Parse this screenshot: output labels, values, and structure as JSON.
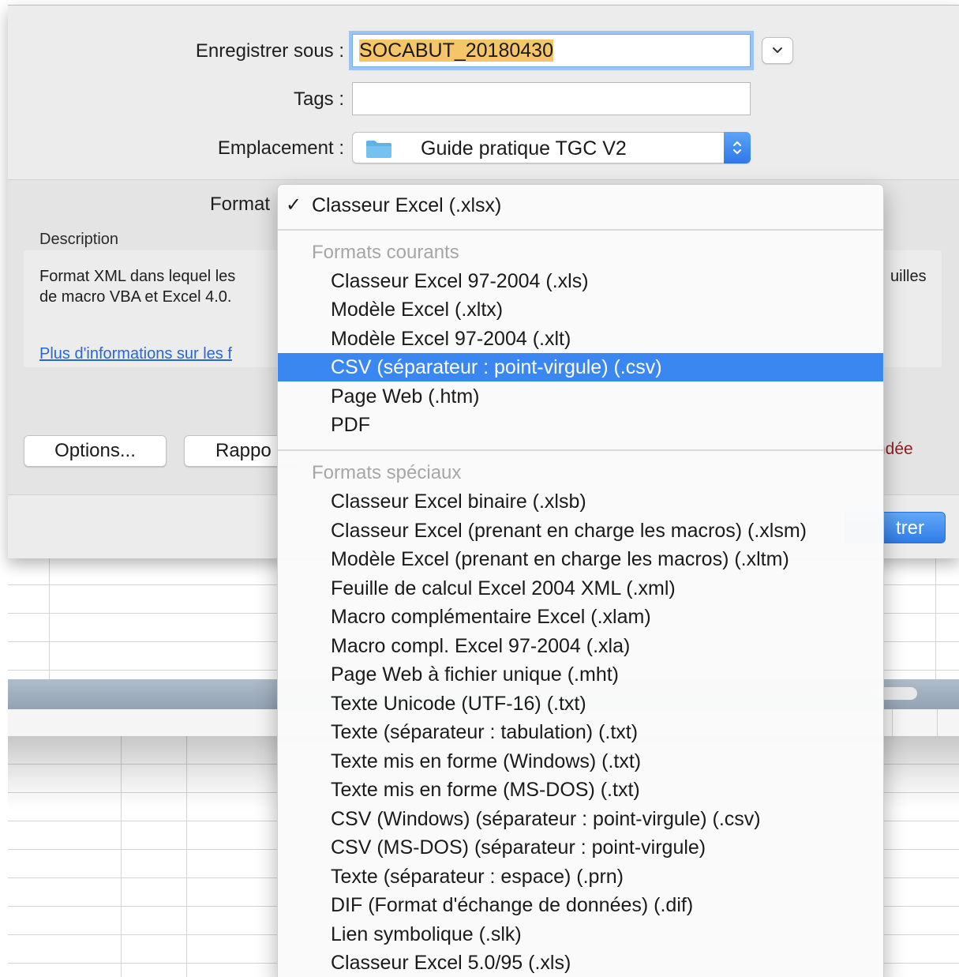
{
  "dialog": {
    "save_as_label": "Enregistrer sous :",
    "save_as_value": "SOCABUT_20180430",
    "tags_label": "Tags :",
    "tags_value": "",
    "location_label": "Emplacement :",
    "location_value": "Guide pratique TGC V2",
    "format_label": "Format",
    "description_heading": "Description",
    "description_text": "Format XML dans lequel les\nde macro VBA et Excel 4.0.",
    "description_text_right": "uilles",
    "description_link": "Plus d'informations sur les f",
    "options_button": "Options...",
    "report_button": "Rappo",
    "warning_text": "ndée",
    "save_button": "trer"
  },
  "format_menu": {
    "selected": {
      "check": "✓",
      "label": "Classeur Excel (.xlsx)"
    },
    "groups": [
      {
        "header": "Formats courants",
        "items": [
          {
            "label": "Classeur Excel 97-2004 (.xls)"
          },
          {
            "label": "Modèle Excel (.xltx)"
          },
          {
            "label": "Modèle Excel 97-2004 (.xlt)"
          },
          {
            "label": "CSV (séparateur : point-virgule) (.csv)",
            "highlighted": true
          },
          {
            "label": "Page Web (.htm)"
          },
          {
            "label": "PDF"
          }
        ]
      },
      {
        "header": "Formats spéciaux",
        "items": [
          {
            "label": "Classeur Excel binaire (.xlsb)"
          },
          {
            "label": "Classeur Excel (prenant en charge les macros) (.xlsm)"
          },
          {
            "label": "Modèle Excel (prenant en charge les macros) (.xltm)"
          },
          {
            "label": "Feuille de calcul Excel 2004 XML (.xml)"
          },
          {
            "label": "Macro complémentaire Excel (.xlam)"
          },
          {
            "label": "Macro compl. Excel 97-2004 (.xla)"
          },
          {
            "label": "Page Web à fichier unique (.mht)"
          },
          {
            "label": "Texte Unicode (UTF-16) (.txt)"
          },
          {
            "label": "Texte (séparateur : tabulation) (.txt)"
          },
          {
            "label": "Texte mis en forme (Windows) (.txt)"
          },
          {
            "label": "Texte mis en forme (MS-DOS) (.txt)"
          },
          {
            "label": "CSV (Windows) (séparateur : point-virgule) (.csv)"
          },
          {
            "label": "CSV (MS-DOS) (séparateur : point-virgule)"
          },
          {
            "label": "Texte (séparateur : espace) (.prn)"
          },
          {
            "label": "DIF (Format d'échange de données) (.dif)"
          },
          {
            "label": "Lien symbolique (.slk)"
          },
          {
            "label": "Classeur Excel 5.0/95 (.xls)"
          }
        ]
      }
    ]
  },
  "icons": {
    "expand": "chevron-down-icon",
    "folder": "folder-icon",
    "stepper": "up-down-stepper-icon",
    "check": "checkmark-icon"
  },
  "colors": {
    "accent": "#3a87f1",
    "selection": "#f5c56a",
    "focus_ring": "#9cc3f2",
    "link": "#2a67d2",
    "warning": "#8b1e1e"
  }
}
